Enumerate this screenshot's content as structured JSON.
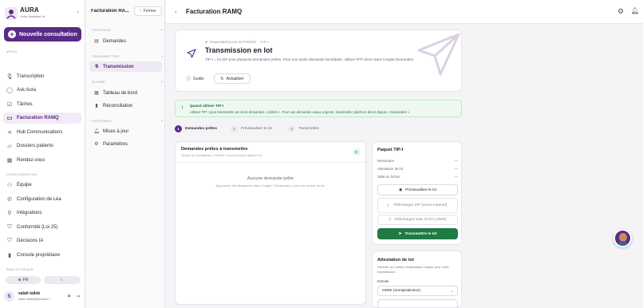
{
  "brand": {
    "name": "AURA",
    "subtitle": "Votre Assistant IA"
  },
  "sidebar": {
    "new_consult_label": "Nouvelle consultation",
    "menu_label": "MENU",
    "items": [
      {
        "label": "Transcription",
        "icon": "microphone-icon"
      },
      {
        "label": "Ask Aura",
        "icon": "chat-icon"
      },
      {
        "label": "Tâches",
        "icon": "checkbox-icon"
      },
      {
        "label": "Facturation RAMQ",
        "icon": "card-icon"
      },
      {
        "label": "Hub Communications",
        "icon": "share-icon"
      },
      {
        "label": "Dossiers patients",
        "icon": "folder-icon"
      },
      {
        "label": "Rendez-vous",
        "icon": "calendar-icon"
      }
    ],
    "config_label": "CONFIGURATION",
    "config_items": [
      {
        "label": "Équipe",
        "icon": "team-icon"
      },
      {
        "label": "Configuration de Léa",
        "icon": "phone-icon"
      },
      {
        "label": "Intégrations",
        "icon": "plug-icon"
      },
      {
        "label": "Conformité (Loi 25)",
        "icon": "shield-icon"
      },
      {
        "label": "Décisions IA",
        "icon": "shield-check-icon"
      },
      {
        "label": "Console propriétaire",
        "icon": "chart-icon"
      }
    ],
    "library_label": "BIBLIOTHÈQUE",
    "lang": "FR",
    "user": {
      "initial": "S",
      "name": "salah taileb",
      "email": "salah.taileb@aurascri..."
    }
  },
  "subnav": {
    "title": "Facturation RA...",
    "close_label": "Fermer",
    "sections": [
      {
        "label": "PROVINCE",
        "items": [
          {
            "label": "Demandes",
            "icon": "doc-icon"
          }
        ]
      },
      {
        "label": "TRANSMETTRE",
        "items": [
          {
            "label": "Transmission",
            "icon": "flask-icon"
          }
        ]
      },
      {
        "label": "SUIVRE",
        "items": [
          {
            "label": "Tableau de bord",
            "icon": "grid-icon"
          },
          {
            "label": "Réconciliation",
            "icon": "bars-icon"
          }
        ]
      },
      {
        "label": "SYSTÈMES",
        "items": [
          {
            "label": "Mises à jour",
            "icon": "bell-icon"
          },
          {
            "label": "Paramètres",
            "icon": "gear-icon"
          }
        ]
      }
    ]
  },
  "header": {
    "title": "Facturation RAMQ"
  },
  "hero": {
    "kicker": "TRANSMISSION DIFFÉRÉE · TIP-I",
    "title": "Transmission en lot",
    "description": "TIP-I = lot ZIP pour plusieurs demandes prêtes. Pour une seule demande immédiate, utilisez FFP direct dans l'onglet Demandes.",
    "guide_label": "Guide",
    "refresh_label": "Actualiser"
  },
  "info": {
    "title": "Quand utiliser TIP-I",
    "text": "Utilisez TIP-I pour transmettre un lot de demandes « prêtes ». Pour une demande unique urgente, transmettez plutôt en direct depuis « Demandes »."
  },
  "steps": [
    {
      "num": "1",
      "label": "Demandes prêtes"
    },
    {
      "num": "2",
      "label": "Prévisualiser le lot"
    },
    {
      "num": "3",
      "label": "Transmettre"
    }
  ],
  "ready_list": {
    "title": "Demandes prêtes à transmettre",
    "subtitle": "Toutes les demandes « Prêtes » sont incluses dans le lot.",
    "count": "0",
    "empty_title": "Aucune demande prête",
    "empty_text": "Approuvez des demandes dans l'onglet « Demandes » pour les inclure au lot."
  },
  "package": {
    "title": "Paquet TIP-I",
    "rows": [
      {
        "label": "Demandes",
        "value": "—"
      },
      {
        "label": "Attestation de lot",
        "value": "—"
      },
      {
        "label": "Taille du fichier",
        "value": "—"
      }
    ],
    "preview_label": "Prévisualiser le lot",
    "zip_label": "Télécharger ZIP (envoi manuel)",
    "xml_label": "Télécharger XML (FICH_DEM)",
    "transmit_label": "Transmettre le lot"
  },
  "attestation": {
    "title": "Attestation de lot",
    "description": "Générer un numéro d'attestation unique pour votre transmission.",
    "entity_label": "Entente",
    "entity_value": "OMNI (omnipraticiens)"
  },
  "colors": {
    "primary": "#5b2a86",
    "green": "#1f7a45",
    "info_bg": "#eef8f1"
  }
}
